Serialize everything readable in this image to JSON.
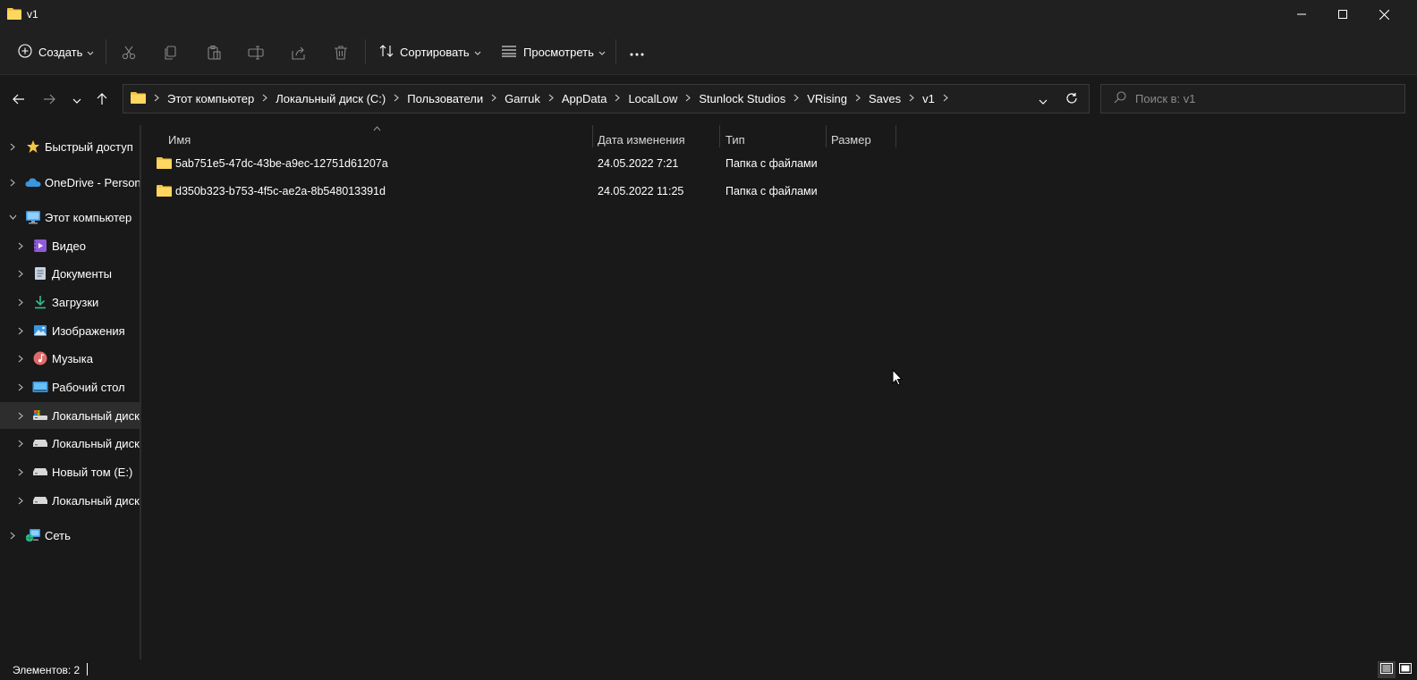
{
  "window": {
    "title": "v1"
  },
  "toolbar": {
    "create_label": "Создать",
    "sort_label": "Сортировать",
    "view_label": "Просмотреть",
    "more_label": "···"
  },
  "address": {
    "crumbs": [
      "Этот компьютер",
      "Локальный диск (C:)",
      "Пользователи",
      "Garruk",
      "AppData",
      "LocalLow",
      "Stunlock Studios",
      "VRising",
      "Saves",
      "v1"
    ]
  },
  "search": {
    "placeholder": "Поиск в: v1"
  },
  "sidebar": {
    "items": [
      {
        "label": "Быстрый доступ",
        "icon": "star-icon"
      },
      {
        "label": "OneDrive - Personal",
        "icon": "cloud-icon"
      },
      {
        "label": "Этот компьютер",
        "icon": "computer-icon"
      },
      {
        "label": "Видео",
        "icon": "video-icon"
      },
      {
        "label": "Документы",
        "icon": "documents-icon"
      },
      {
        "label": "Загрузки",
        "icon": "download-icon"
      },
      {
        "label": "Изображения",
        "icon": "pictures-icon"
      },
      {
        "label": "Музыка",
        "icon": "music-icon"
      },
      {
        "label": "Рабочий стол",
        "icon": "desktop-icon"
      },
      {
        "label": "Локальный диск (",
        "icon": "system-drive-icon"
      },
      {
        "label": "Локальный диск (",
        "icon": "drive-icon"
      },
      {
        "label": "Новый том (E:)",
        "icon": "drive-icon"
      },
      {
        "label": "Локальный диск (",
        "icon": "drive-icon"
      },
      {
        "label": "Сеть",
        "icon": "network-icon"
      }
    ]
  },
  "columns": {
    "name": "Имя",
    "modified": "Дата изменения",
    "type": "Тип",
    "size": "Размер"
  },
  "files": [
    {
      "name": "5ab751e5-47dc-43be-a9ec-12751d61207a",
      "modified": "24.05.2022 7:21",
      "type": "Папка с файлами",
      "size": ""
    },
    {
      "name": "d350b323-b753-4f5c-ae2a-8b548013391d",
      "modified": "24.05.2022 11:25",
      "type": "Папка с файлами",
      "size": ""
    }
  ],
  "status": {
    "count": "Элементов: 2"
  },
  "colors": {
    "background": "#191919",
    "chrome": "#202020",
    "folder": "#f4c542",
    "accent": "#4cc2ff"
  }
}
